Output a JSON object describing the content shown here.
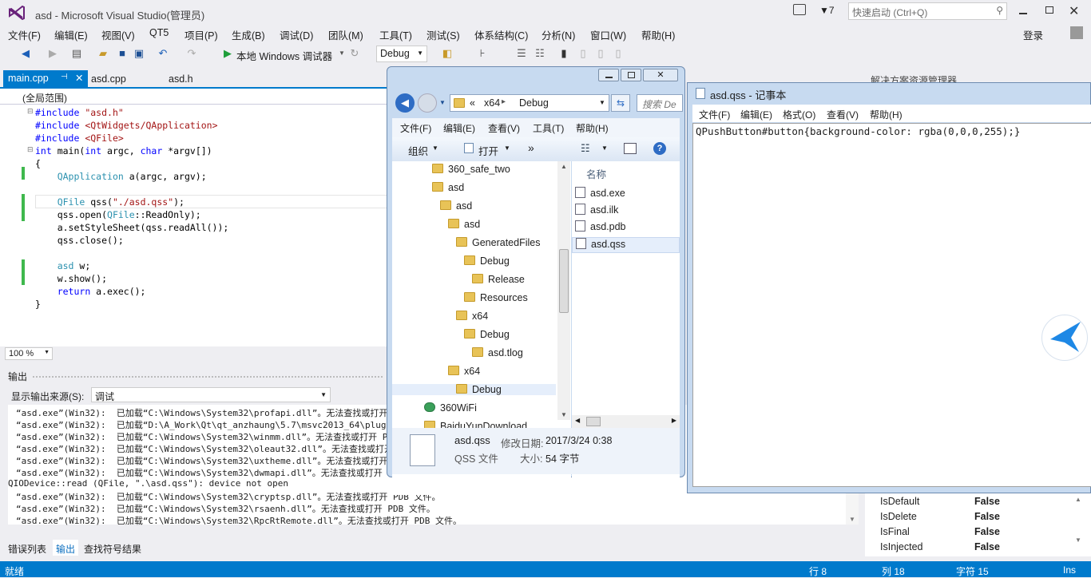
{
  "vs": {
    "title": "asd - Microsoft Visual Studio(管理员)",
    "notif_count": "7",
    "quicklaunch_placeholder": "快速启动 (Ctrl+Q)",
    "menu": [
      "文件(F)",
      "编辑(E)",
      "视图(V)",
      "QT5",
      "项目(P)",
      "生成(B)",
      "调试(D)",
      "团队(M)",
      "工具(T)",
      "测试(S)",
      "体系结构(C)",
      "分析(N)",
      "窗口(W)",
      "帮助(H)"
    ],
    "login": "登录",
    "debugger_label": "本地 Windows 调试器",
    "config": "Debug",
    "tabs": [
      "main.cpp",
      "asd.cpp",
      "asd.h"
    ],
    "scope": "(全局范围)",
    "zoom": "100 %",
    "solution_explorer_title": "解决方案资源管理器"
  },
  "code_lines": [
    {
      "t": "#include \"asd.h\""
    },
    {
      "t": "#include <QtWidgets/QApplication>"
    },
    {
      "t": "#include <QFile>"
    },
    {
      "t": "int main(int argc, char *argv[])"
    },
    {
      "t": "{"
    },
    {
      "t": "    QApplication a(argc, argv);"
    },
    {
      "t": ""
    },
    {
      "t": "    QFile qss(\"./asd.qss\");"
    },
    {
      "t": "    qss.open(QFile::ReadOnly);"
    },
    {
      "t": "    a.setStyleSheet(qss.readAll());"
    },
    {
      "t": "    qss.close();"
    },
    {
      "t": ""
    },
    {
      "t": "    asd w;"
    },
    {
      "t": "    w.show();"
    },
    {
      "t": "    return a.exec();"
    },
    {
      "t": "}"
    }
  ],
  "output": {
    "title": "输出",
    "source_label": "显示输出来源(S):",
    "source_value": "调试",
    "lines": [
      "“asd.exe”(Win32):  已加载“C:\\Windows\\System32\\profapi.dll”。无法查找或打开",
      "“asd.exe”(Win32):  已加载“D:\\A_Work\\Qt\\qt_anzhaung\\5.7\\msvc2013_64\\plugins\\",
      "“asd.exe”(Win32):  已加载“C:\\Windows\\System32\\winmm.dll”。无法查找或打开 P",
      "“asd.exe”(Win32):  已加载“C:\\Windows\\System32\\oleaut32.dll”。无法查找或打开",
      "“asd.exe”(Win32):  已加载“C:\\Windows\\System32\\uxtheme.dll”。无法查找或打开",
      "“asd.exe”(Win32):  已加载“C:\\Windows\\System32\\dwmapi.dll”。无法查找或打开",
      "QIODevice::read (QFile, \".\\asd.qss\"): device not open",
      "“asd.exe”(Win32):  已加载“C:\\Windows\\System32\\cryptsp.dll”。无法查找或打开 PDB 文件。",
      "“asd.exe”(Win32):  已加载“C:\\Windows\\System32\\rsaenh.dll”。无法查找或打开 PDB 文件。",
      "“asd.exe”(Win32):  已加载“C:\\Windows\\System32\\RpcRtRemote.dll”。无法查找或打开 PDB 文件。"
    ]
  },
  "bottom_tabs": [
    "错误列表",
    "输出",
    "查找符号结果"
  ],
  "status": {
    "ready": "就绪",
    "line": "行 8",
    "col": "列 18",
    "char": "字符 15",
    "ins": "Ins"
  },
  "properties": [
    {
      "name": "IsDefault",
      "value": "False"
    },
    {
      "name": "IsDelete",
      "value": "False"
    },
    {
      "name": "IsFinal",
      "value": "False"
    },
    {
      "name": "IsInjected",
      "value": "False"
    }
  ],
  "explorer": {
    "path": [
      "«",
      "x64",
      "Debug"
    ],
    "search_placeholder": "搜索 De",
    "menu": [
      "文件(F)",
      "编辑(E)",
      "查看(V)",
      "工具(T)",
      "帮助(H)"
    ],
    "organize": "组织",
    "open": "打开",
    "more": "»",
    "tree": [
      {
        "label": "360_safe_two",
        "lvl": 0
      },
      {
        "label": "asd",
        "lvl": 0
      },
      {
        "label": "asd",
        "lvl": 1
      },
      {
        "label": "asd",
        "lvl": 2
      },
      {
        "label": "GeneratedFiles",
        "lvl": 3
      },
      {
        "label": "Debug",
        "lvl": 4
      },
      {
        "label": "Release",
        "lvl": 4
      },
      {
        "label": "Resources",
        "lvl": 3
      },
      {
        "label": "x64",
        "lvl": 3
      },
      {
        "label": "Debug",
        "lvl": 4
      },
      {
        "label": "asd.tlog",
        "lvl": 5
      },
      {
        "label": "x64",
        "lvl": 2
      },
      {
        "label": "Debug",
        "lvl": 3
      },
      {
        "label": "360WiFi",
        "lvl": 0
      },
      {
        "label": "BaiduYunDownload",
        "lvl": 0
      }
    ],
    "col_name": "名称",
    "files": [
      "asd.exe",
      "asd.ilk",
      "asd.pdb",
      "asd.qss"
    ],
    "detail_name": "asd.qss",
    "detail_type": "QSS 文件",
    "detail_modified_label": "修改日期:",
    "detail_modified": "2017/3/24 0:38",
    "detail_size_label": "大小:",
    "detail_size": "54 字节"
  },
  "notepad": {
    "title": "asd.qss - 记事本",
    "menu": [
      "文件(F)",
      "编辑(E)",
      "格式(O)",
      "查看(V)",
      "帮助(H)"
    ],
    "content": "QPushButton#button{background-color: rgba(0,0,0,255);}"
  },
  "colors": {
    "vs_blue": "#007acc",
    "folder": "#e8c357",
    "green_bar": "#3fb84d"
  }
}
